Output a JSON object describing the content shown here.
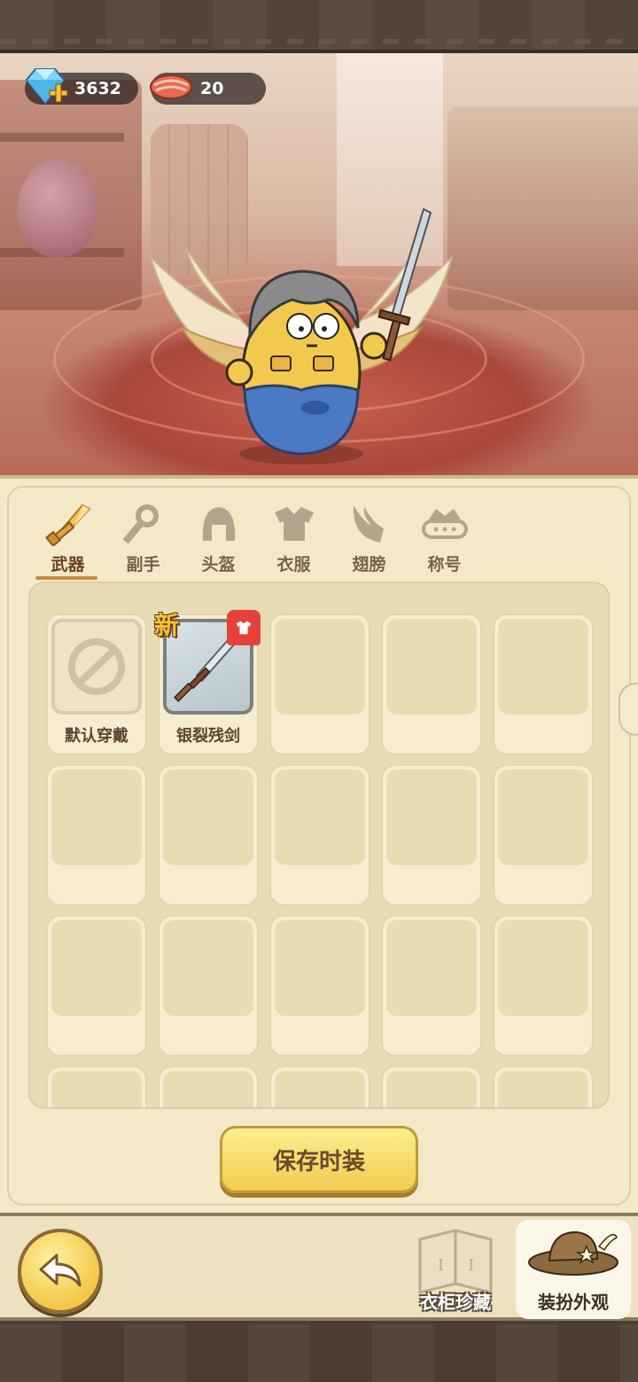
{
  "currency": {
    "gems": "3632",
    "meat": "20"
  },
  "tabs": [
    {
      "label": "武器",
      "active": true,
      "icon": "sword-icon"
    },
    {
      "label": "副手",
      "active": false,
      "icon": "offhand-icon"
    },
    {
      "label": "头盔",
      "active": false,
      "icon": "helmet-icon"
    },
    {
      "label": "衣服",
      "active": false,
      "icon": "armor-icon"
    },
    {
      "label": "翅膀",
      "active": false,
      "icon": "wing-icon"
    },
    {
      "label": "称号",
      "active": false,
      "icon": "title-crown-icon"
    }
  ],
  "items": [
    {
      "name": "默认穿戴",
      "type": "default"
    },
    {
      "name": "银裂残剑",
      "type": "item",
      "badge": "新"
    }
  ],
  "save_button": "保存时装",
  "bottom_nav": {
    "wardrobe": "衣柜珍藏",
    "dress_up": "装扮外观"
  },
  "colors": {
    "panel_bg": "#f3e9c9",
    "accent_gold": "#f3cc4f",
    "tab_active": "#6b3f22"
  }
}
